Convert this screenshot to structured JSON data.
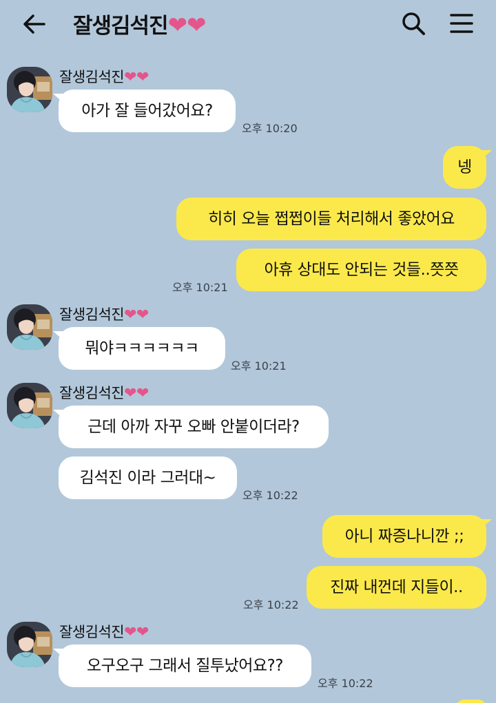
{
  "header": {
    "title": "잘생김석진",
    "title_hearts": "❤❤",
    "back_icon": "arrow-left-icon",
    "search_icon": "search-icon",
    "menu_icon": "hamburger-menu-icon"
  },
  "colors": {
    "background": "#b2c7da",
    "incoming_bubble": "#ffffff",
    "outgoing_bubble": "#fbe94b",
    "heart": "#e4568b"
  },
  "contact": {
    "name": "잘생김석진",
    "hearts": "❤❤"
  },
  "messages": [
    {
      "from": "them",
      "text": "아가 잘 들어갔어요?"
    },
    {
      "time": "오후 10:20"
    },
    {
      "from": "me",
      "text": "넹"
    },
    {
      "from": "me",
      "text": "히히 오늘 쩝쩝이들 처리해서 좋았어요"
    },
    {
      "from": "me",
      "text": "아휴 상대도 안되는 것들..쯧쯧"
    },
    {
      "time": "오후 10:21"
    },
    {
      "from": "them",
      "text": "뭐야ㅋㅋㅋㅋㅋㅋ"
    },
    {
      "time": "오후 10:21"
    },
    {
      "from": "them",
      "text": "근데 아까 자꾸 오빠 안붙이더라?"
    },
    {
      "from": "them",
      "text": "김석진 이라 그러대~"
    },
    {
      "time": "오후 10:22"
    },
    {
      "from": "me",
      "text": "아니 짜증나니깐 ;;"
    },
    {
      "from": "me",
      "text": "진짜 내껀데 지들이.."
    },
    {
      "time": "오후 10:22"
    },
    {
      "from": "them",
      "text": "오구오구 그래서 질투났어요??"
    },
    {
      "time": "오후 10:22"
    }
  ]
}
